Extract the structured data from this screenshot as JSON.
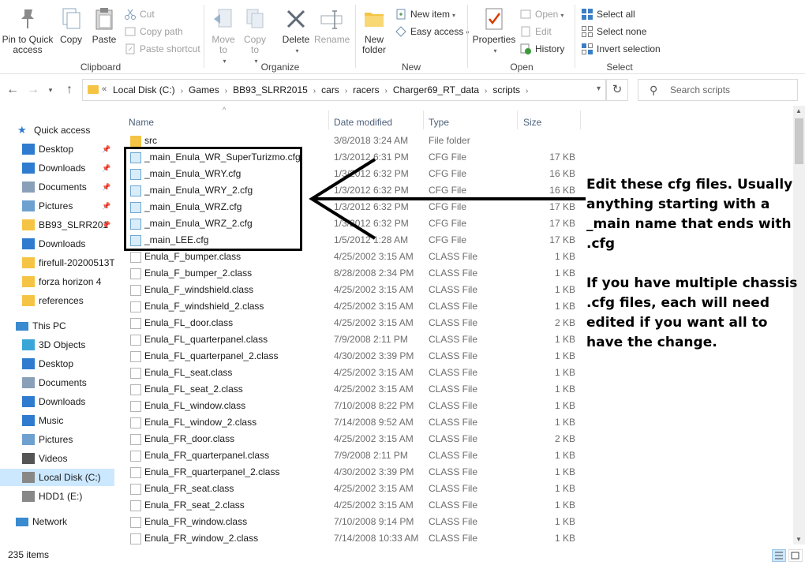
{
  "ribbon": {
    "clipboard": {
      "label": "Clipboard",
      "pin": "Pin to Quick access",
      "copy": "Copy",
      "paste": "Paste",
      "cut": "Cut",
      "copy_path": "Copy path",
      "paste_shortcut": "Paste shortcut"
    },
    "organize": {
      "label": "Organize",
      "move_to": "Move to",
      "copy_to": "Copy to",
      "delete": "Delete",
      "rename": "Rename"
    },
    "new": {
      "label": "New",
      "new_folder": "New folder",
      "new_item": "New item",
      "easy_access": "Easy access"
    },
    "open": {
      "label": "Open",
      "properties": "Properties",
      "open": "Open",
      "edit": "Edit",
      "history": "History"
    },
    "select": {
      "label": "Select",
      "select_all": "Select all",
      "select_none": "Select none",
      "invert": "Invert selection"
    }
  },
  "address": {
    "crumbs": [
      "Local Disk (C:)",
      "Games",
      "BB93_SLRR2015",
      "cars",
      "racers",
      "Charger69_RT_data",
      "scripts"
    ],
    "search_placeholder": "Search scripts"
  },
  "nav": {
    "quick_access": "Quick access",
    "quick_items": [
      "Desktop",
      "Downloads",
      "Documents",
      "Pictures",
      "BB93_SLRR201",
      "Downloads",
      "firefull-20200513T",
      "forza horizon 4",
      "references"
    ],
    "this_pc": "This PC",
    "pc_items": [
      "3D Objects",
      "Desktop",
      "Documents",
      "Downloads",
      "Music",
      "Pictures",
      "Videos",
      "Local Disk (C:)",
      "HDD1 (E:)"
    ],
    "network": "Network"
  },
  "columns": {
    "name": "Name",
    "date": "Date modified",
    "type": "Type",
    "size": "Size"
  },
  "files": [
    {
      "name": "src",
      "date": "3/8/2018 3:24 AM",
      "type": "File folder",
      "size": "",
      "kind": "folder"
    },
    {
      "name": "_main_Enula_WR_SuperTurizmo.cfg",
      "date": "1/3/2012 6:31 PM",
      "type": "CFG File",
      "size": "17 KB",
      "kind": "cfg"
    },
    {
      "name": "_main_Enula_WRY.cfg",
      "date": "1/3/2012 6:32 PM",
      "type": "CFG File",
      "size": "16 KB",
      "kind": "cfg"
    },
    {
      "name": "_main_Enula_WRY_2.cfg",
      "date": "1/3/2012 6:32 PM",
      "type": "CFG File",
      "size": "16 KB",
      "kind": "cfg"
    },
    {
      "name": "_main_Enula_WRZ.cfg",
      "date": "1/3/2012 6:32 PM",
      "type": "CFG File",
      "size": "17 KB",
      "kind": "cfg"
    },
    {
      "name": "_main_Enula_WRZ_2.cfg",
      "date": "1/3/2012 6:32 PM",
      "type": "CFG File",
      "size": "17 KB",
      "kind": "cfg"
    },
    {
      "name": "_main_LEE.cfg",
      "date": "1/5/2012 1:28 AM",
      "type": "CFG File",
      "size": "17 KB",
      "kind": "cfg"
    },
    {
      "name": "Enula_F_bumper.class",
      "date": "4/25/2002 3:15 AM",
      "type": "CLASS File",
      "size": "1 KB",
      "kind": "class"
    },
    {
      "name": "Enula_F_bumper_2.class",
      "date": "8/28/2008 2:34 PM",
      "type": "CLASS File",
      "size": "1 KB",
      "kind": "class"
    },
    {
      "name": "Enula_F_windshield.class",
      "date": "4/25/2002 3:15 AM",
      "type": "CLASS File",
      "size": "1 KB",
      "kind": "class"
    },
    {
      "name": "Enula_F_windshield_2.class",
      "date": "4/25/2002 3:15 AM",
      "type": "CLASS File",
      "size": "1 KB",
      "kind": "class"
    },
    {
      "name": "Enula_FL_door.class",
      "date": "4/25/2002 3:15 AM",
      "type": "CLASS File",
      "size": "2 KB",
      "kind": "class"
    },
    {
      "name": "Enula_FL_quarterpanel.class",
      "date": "7/9/2008 2:11 PM",
      "type": "CLASS File",
      "size": "1 KB",
      "kind": "class"
    },
    {
      "name": "Enula_FL_quarterpanel_2.class",
      "date": "4/30/2002 3:39 PM",
      "type": "CLASS File",
      "size": "1 KB",
      "kind": "class"
    },
    {
      "name": "Enula_FL_seat.class",
      "date": "4/25/2002 3:15 AM",
      "type": "CLASS File",
      "size": "1 KB",
      "kind": "class"
    },
    {
      "name": "Enula_FL_seat_2.class",
      "date": "4/25/2002 3:15 AM",
      "type": "CLASS File",
      "size": "1 KB",
      "kind": "class"
    },
    {
      "name": "Enula_FL_window.class",
      "date": "7/10/2008 8:22 PM",
      "type": "CLASS File",
      "size": "1 KB",
      "kind": "class"
    },
    {
      "name": "Enula_FL_window_2.class",
      "date": "7/14/2008 9:52 AM",
      "type": "CLASS File",
      "size": "1 KB",
      "kind": "class"
    },
    {
      "name": "Enula_FR_door.class",
      "date": "4/25/2002 3:15 AM",
      "type": "CLASS File",
      "size": "2 KB",
      "kind": "class"
    },
    {
      "name": "Enula_FR_quarterpanel.class",
      "date": "7/9/2008 2:11 PM",
      "type": "CLASS File",
      "size": "1 KB",
      "kind": "class"
    },
    {
      "name": "Enula_FR_quarterpanel_2.class",
      "date": "4/30/2002 3:39 PM",
      "type": "CLASS File",
      "size": "1 KB",
      "kind": "class"
    },
    {
      "name": "Enula_FR_seat.class",
      "date": "4/25/2002 3:15 AM",
      "type": "CLASS File",
      "size": "1 KB",
      "kind": "class"
    },
    {
      "name": "Enula_FR_seat_2.class",
      "date": "4/25/2002 3:15 AM",
      "type": "CLASS File",
      "size": "1 KB",
      "kind": "class"
    },
    {
      "name": "Enula_FR_window.class",
      "date": "7/10/2008 9:14 PM",
      "type": "CLASS File",
      "size": "1 KB",
      "kind": "class"
    },
    {
      "name": "Enula_FR_window_2.class",
      "date": "7/14/2008 10:33 AM",
      "type": "CLASS File",
      "size": "1 KB",
      "kind": "class"
    }
  ],
  "status": {
    "item_count": "235 items"
  },
  "annotation": {
    "para1": "Edit these cfg files. Usually anything starting with a _main name that ends with .cfg",
    "para2": "If you have multiple chassis .cfg files, each will need edited if you want all to have the change."
  },
  "colors": {
    "accent": "#0078d7",
    "selection": "#cce8ff",
    "folder": "#f5c445"
  }
}
